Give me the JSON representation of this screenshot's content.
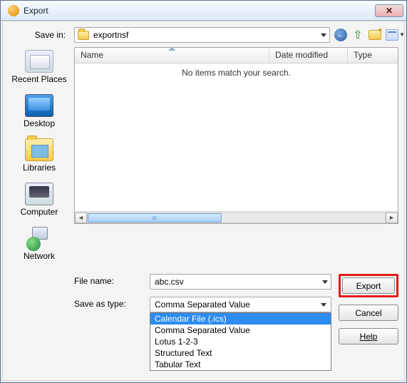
{
  "title": "Export",
  "savein_label": "Save in:",
  "savein_value": "exportnsf",
  "columns": {
    "name": "Name",
    "date": "Date modified",
    "type": "Type"
  },
  "empty_msg": "No items match your search.",
  "places": {
    "recent": "Recent Places",
    "desktop": "Desktop",
    "libraries": "Libraries",
    "computer": "Computer",
    "network": "Network"
  },
  "filename_label": "File name:",
  "filename_value": "abc.csv",
  "savetype_label": "Save as type:",
  "savetype_value": "Comma Separated Value",
  "savetype_options": [
    "Calendar File (.ics)",
    "Comma Separated Value",
    "Lotus 1-2-3",
    "Structured Text",
    "Tabular Text"
  ],
  "buttons": {
    "export": "Export",
    "cancel": "Cancel",
    "help": "Help"
  }
}
